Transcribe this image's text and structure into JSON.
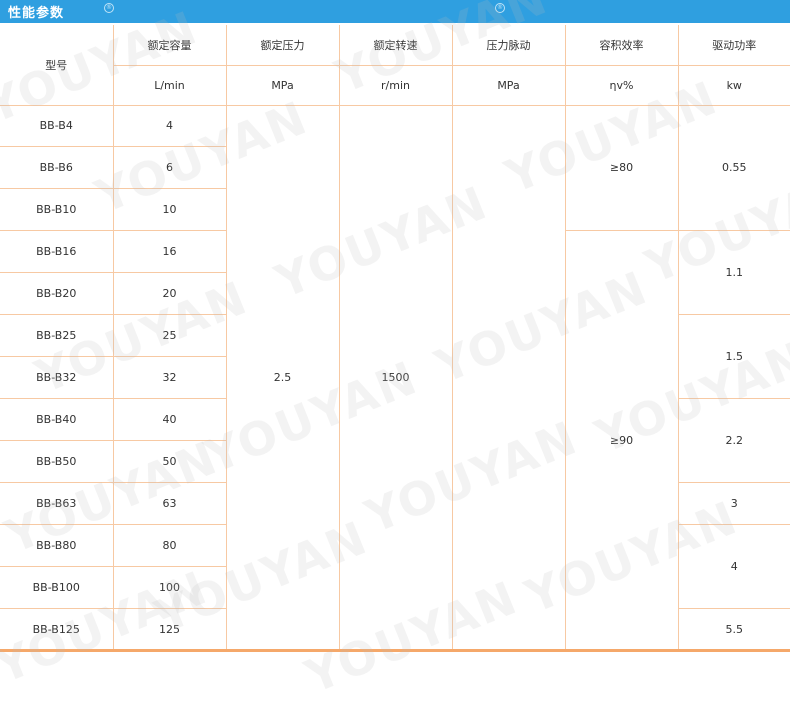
{
  "title": "性能参数",
  "watermark": "YOUYAN",
  "colors": {
    "title_bar": "#2f9fe0",
    "border": "#f7c9a3",
    "bottom_line": "#f5a86a"
  },
  "headers": {
    "model": "型号",
    "flow": {
      "name": "额定容量",
      "unit": "L/min"
    },
    "pressure": {
      "name": "额定压力",
      "unit": "MPa"
    },
    "speed": {
      "name": "额定转速",
      "unit": "r/min"
    },
    "pulse": {
      "name": "压力脉动",
      "unit": "MPa"
    },
    "efficiency": {
      "name": "容积效率",
      "unit": "ηv%"
    },
    "power": {
      "name": "驱动功率",
      "unit": "kw"
    }
  },
  "rows": [
    {
      "model": "BB-B4",
      "flow": "4"
    },
    {
      "model": "BB-B6",
      "flow": "6"
    },
    {
      "model": "BB-B10",
      "flow": "10"
    },
    {
      "model": "BB-B16",
      "flow": "16"
    },
    {
      "model": "BB-B20",
      "flow": "20"
    },
    {
      "model": "BB-B25",
      "flow": "25"
    },
    {
      "model": "BB-B32",
      "flow": "32"
    },
    {
      "model": "BB-B40",
      "flow": "40"
    },
    {
      "model": "BB-B50",
      "flow": "50"
    },
    {
      "model": "BB-B63",
      "flow": "63"
    },
    {
      "model": "BB-B80",
      "flow": "80"
    },
    {
      "model": "BB-B100",
      "flow": "100"
    },
    {
      "model": "BB-B125",
      "flow": "125"
    }
  ],
  "pressure_value": "2.5",
  "speed_value": "1500",
  "pulse_value": "",
  "efficiency_groups": [
    {
      "value": "≥80"
    },
    {
      "value": "≥90"
    }
  ],
  "power_groups": [
    {
      "value": "0.55"
    },
    {
      "value": "1.1"
    },
    {
      "value": "1.5"
    },
    {
      "value": "2.2"
    },
    {
      "value": "3"
    },
    {
      "value": "4"
    },
    {
      "value": "5.5"
    }
  ]
}
